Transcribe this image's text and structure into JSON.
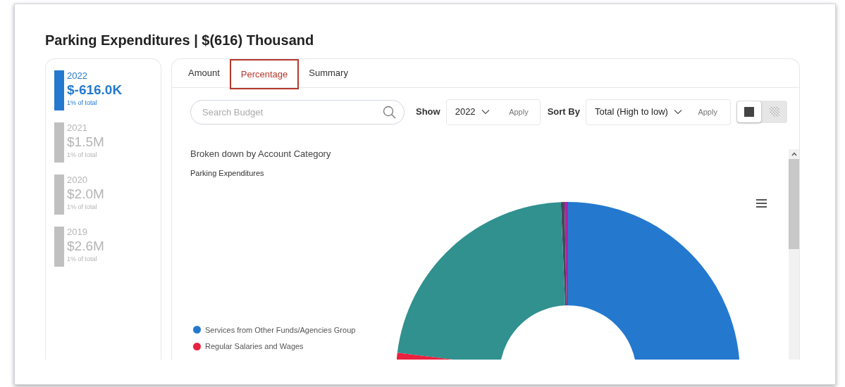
{
  "title": "Parking Expenditures | $(616) Thousand",
  "years": [
    {
      "year": "2022",
      "amount": "$-616.0K",
      "share": "1% of total",
      "selected": true
    },
    {
      "year": "2021",
      "amount": "$1.5M",
      "share": "1% of total",
      "selected": false
    },
    {
      "year": "2020",
      "amount": "$2.0M",
      "share": "1% of total",
      "selected": false
    },
    {
      "year": "2019",
      "amount": "$2.6M",
      "share": "1% of total",
      "selected": false
    }
  ],
  "tabs": [
    {
      "label": "Amount",
      "selected": false
    },
    {
      "label": "Percentage",
      "selected": true
    },
    {
      "label": "Summary",
      "selected": false
    }
  ],
  "search": {
    "placeholder": "Search Budget"
  },
  "show": {
    "label": "Show",
    "value": "2022",
    "apply": "Apply"
  },
  "sort": {
    "label": "Sort By",
    "value": "Total (High to low)",
    "apply": "Apply"
  },
  "view_toggle": [
    {
      "kind": "solid",
      "selected": true
    },
    {
      "kind": "hatched",
      "selected": false
    }
  ],
  "chart": {
    "heading": "Broken down by Account Category",
    "title": "Parking Expenditures",
    "legend": [
      {
        "label": "Services from Other Funds/Agencies Group",
        "color": "#2479cf"
      },
      {
        "label": "Regular Salaries and Wages",
        "color": "#e8223f"
      }
    ]
  }
}
